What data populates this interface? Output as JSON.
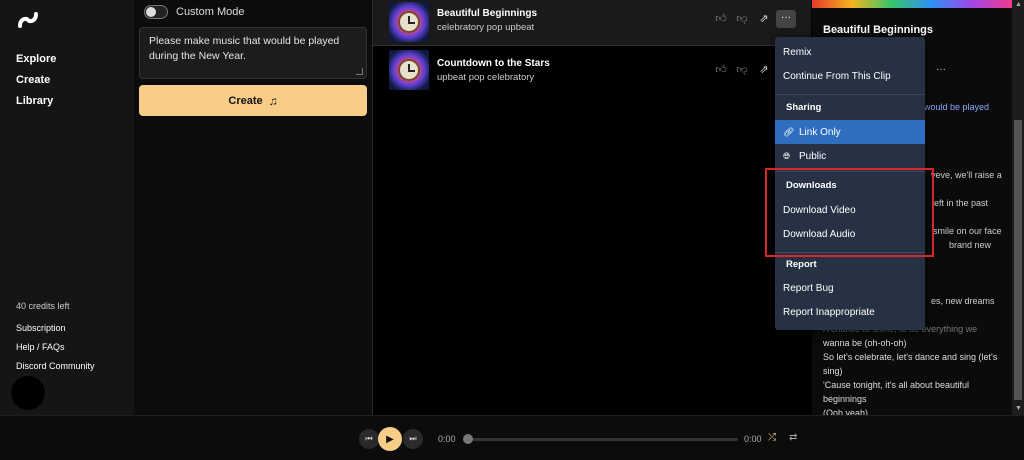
{
  "sidebar": {
    "nav": [
      "Explore",
      "Create",
      "Library"
    ],
    "credits": "40 credits left",
    "links": [
      "Subscription",
      "Help / FAQs",
      "Discord Community"
    ]
  },
  "create": {
    "custom_mode_label": "Custom Mode",
    "prompt_lines": [
      "Please make music that would be played",
      "during the New Year."
    ],
    "create_button": "Create"
  },
  "songs": [
    {
      "title": "Beautiful Beginnings",
      "tags": "celebratory pop upbeat"
    },
    {
      "title": "Countdown to the Stars",
      "tags": "upbeat pop celebratory"
    }
  ],
  "menu": {
    "remix": "Remix",
    "continue": "Continue From This Clip",
    "sharing_header": "Sharing",
    "link_only": "Link Only",
    "public": "Public",
    "downloads_header": "Downloads",
    "download_video": "Download Video",
    "download_audio": "Download Audio",
    "report_header": "Report",
    "report_bug": "Report Bug",
    "report_inappropriate": "Report Inappropriate"
  },
  "detail": {
    "title": "Beautiful Beginnings",
    "fragments": [
      "would be played",
      "veve, we'll raise a",
      "eft in the past",
      "smile on our face",
      "brand new",
      "es, new dreams",
      "A chance to shine, to be everything we"
    ],
    "lyrics": [
      "wanna be (oh-oh-oh)",
      "So let's celebrate, let's dance and sing (let's",
      "sing)",
      "'Cause tonight, it's all about beautiful",
      "beginnings",
      "(Ooh yeah)"
    ]
  },
  "player": {
    "current_time": "0:00",
    "duration": "0:00",
    "progress": 0
  },
  "colors": {
    "accent": "#f7cd88",
    "menu_bg": "#263244",
    "menu_active": "#2f6fbf",
    "highlight": "#d9262b"
  }
}
